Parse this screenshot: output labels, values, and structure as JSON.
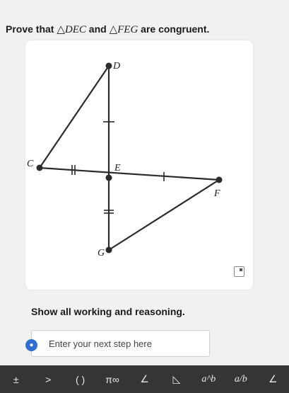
{
  "question": {
    "prefix": "Prove that",
    "triangle1": "△DEC",
    "and": "and",
    "triangle2": "△FEG",
    "suffix": "are congruent."
  },
  "diagram": {
    "points": {
      "D": "D",
      "C": "C",
      "E": "E",
      "F": "F",
      "G": "G"
    },
    "stroke_color": "#2b2b2b"
  },
  "instructions": "Show all working and reasoning.",
  "answer_input": {
    "placeholder": "Enter your next step here",
    "value": ""
  },
  "hint_icon": "lightbulb-icon",
  "toolbar": {
    "items": [
      {
        "name": "plus-minus-icon",
        "glyph": "±"
      },
      {
        "name": "greater-equal-icon",
        "glyph": ">"
      },
      {
        "name": "parentheses-icon",
        "glyph": "( )"
      },
      {
        "name": "pi-infinity-icon",
        "glyph": "π∞"
      },
      {
        "name": "angle-icon",
        "glyph": "∠"
      },
      {
        "name": "triangle-icon",
        "glyph": "◺"
      },
      {
        "name": "power-icon",
        "glyph": "a^b"
      },
      {
        "name": "fraction-icon",
        "glyph": "a/b"
      },
      {
        "name": "angle-symbol-icon",
        "glyph": "∠"
      }
    ]
  }
}
